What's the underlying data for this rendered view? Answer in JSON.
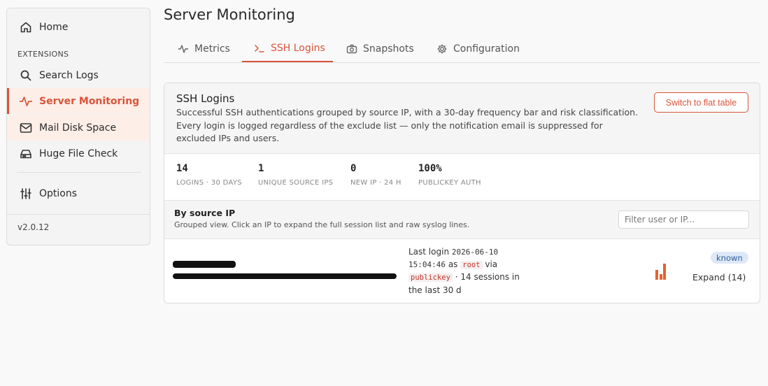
{
  "sidebar": {
    "home": "Home",
    "section_label": "EXTENSIONS",
    "items": [
      {
        "label": "Search Logs",
        "icon": "search-icon"
      },
      {
        "label": "Server Monitoring",
        "icon": "pulse-icon"
      },
      {
        "label": "Mail Disk Space",
        "icon": "mail-icon"
      },
      {
        "label": "Huge File Check",
        "icon": "drive-icon"
      }
    ],
    "options": "Options",
    "version": "v2.0.12"
  },
  "page_title": "Server Monitoring",
  "tabs": [
    {
      "label": "Metrics",
      "icon": "pulse-icon"
    },
    {
      "label": "SSH Logins",
      "icon": "terminal-icon",
      "active": true
    },
    {
      "label": "Snapshots",
      "icon": "camera-icon"
    },
    {
      "label": "Configuration",
      "icon": "gear-icon"
    }
  ],
  "card": {
    "title": "SSH Logins",
    "description": "Successful SSH authentications grouped by source IP, with a 30-day frequency bar and risk classification. Every login is logged regardless of the exclude list — only the notification email is suppressed for excluded IPs and users.",
    "flat_button": "Switch to flat table"
  },
  "stats": [
    {
      "value": "14",
      "label": "LOGINS · 30 DAYS"
    },
    {
      "value": "1",
      "label": "UNIQUE SOURCE IPS"
    },
    {
      "value": "0",
      "label": "NEW IP · 24 H"
    },
    {
      "value": "100%",
      "label": "PUBLICKEY AUTH"
    }
  ],
  "group": {
    "title": "By source IP",
    "subtitle": "Grouped view. Click an IP to expand the full session list and raw syslog lines.",
    "filter_placeholder": "Filter user or IP..."
  },
  "row": {
    "last_login_label": "Last login",
    "date": "2026-06-10",
    "time": "15:04:46",
    "as_text": "as",
    "user": "root",
    "via_text": "via",
    "method": "publickey",
    "sessions_text": "· 14 sessions in the last 30 d",
    "badge": "known",
    "expand": "Expand (14)"
  },
  "colors": {
    "accent": "#d9553a",
    "badge_bg": "#dde8f7",
    "badge_fg": "#2f5d9b"
  }
}
